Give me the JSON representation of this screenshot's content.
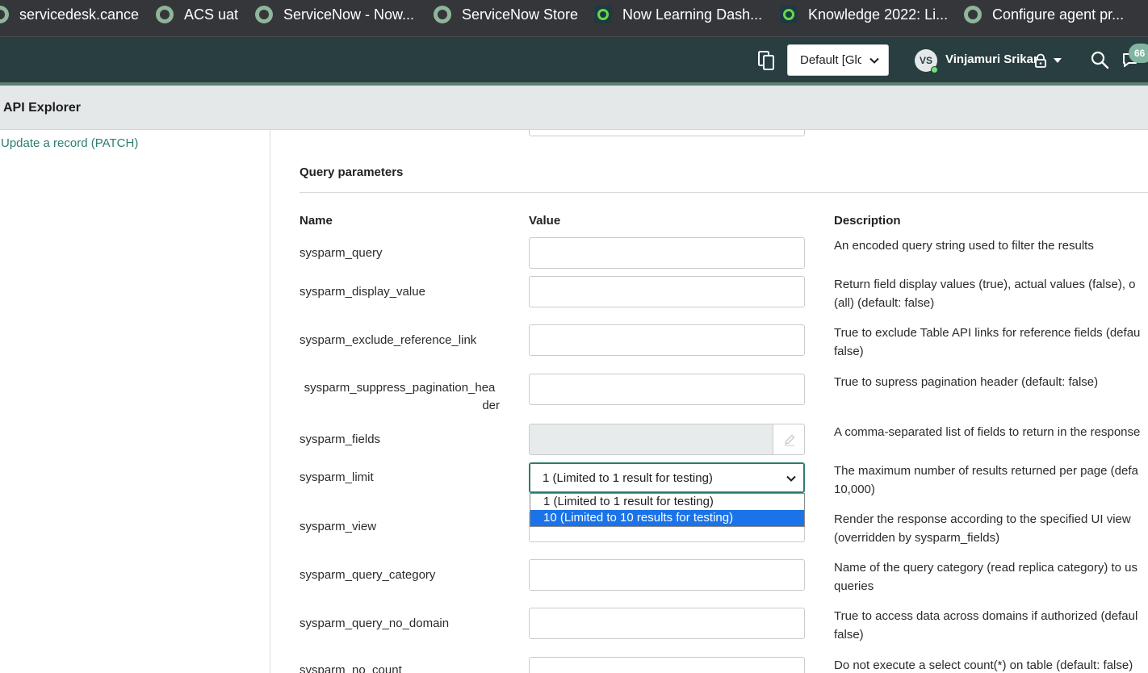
{
  "bookmarks": [
    {
      "label": "servicedesk.cance",
      "icon": "servicenow-icon"
    },
    {
      "label": "ACS uat",
      "icon": "servicenow-icon"
    },
    {
      "label": "ServiceNow - Now...",
      "icon": "servicenow-icon"
    },
    {
      "label": "ServiceNow Store",
      "icon": "servicenow-icon"
    },
    {
      "label": "Now Learning Dash...",
      "icon": "now-learning-icon"
    },
    {
      "label": "Knowledge 2022: Li...",
      "icon": "now-learning-icon"
    },
    {
      "label": "Configure agent pr...",
      "icon": "servicenow-icon"
    }
  ],
  "header": {
    "scope_value": "Default [Global]",
    "user_initials": "VS",
    "user_name": "Vinjamuri Srikar",
    "notification_count": "66"
  },
  "page": {
    "title": "API Explorer"
  },
  "leftnav": {
    "link_label": "Update a record  (PATCH)"
  },
  "query": {
    "section_title": "Query parameters",
    "columns": {
      "name": "Name",
      "value": "Value",
      "description": "Description"
    },
    "params": [
      {
        "name": "sysparm_query",
        "value": "",
        "desc1": "An encoded query string used to filter the results",
        "desc2": ""
      },
      {
        "name": "sysparm_display_value",
        "value": "",
        "desc1": "Return field display values (true), actual values (false), o",
        "desc2": "(all) (default: false)"
      },
      {
        "name": "sysparm_exclude_reference_link",
        "value": "",
        "desc1": "True to exclude Table API links for reference fields (defau",
        "desc2": "false)"
      },
      {
        "name_line1": "sysparm_suppress_pagination_hea",
        "name_line2": "der",
        "value": "",
        "desc1": "True to supress pagination header (default: false)",
        "desc2": ""
      },
      {
        "name": "sysparm_fields",
        "value": "",
        "desc1": "A comma-separated list of fields to return in the response",
        "desc2": ""
      },
      {
        "name": "sysparm_limit",
        "value": "1 (Limited to 1 result for testing)",
        "desc1": "The maximum number of results returned per page (defa",
        "desc2": "10,000)"
      },
      {
        "name": "sysparm_view",
        "value": "",
        "desc1": "Render the response according to the specified UI view",
        "desc2": "(overridden by sysparm_fields)"
      },
      {
        "name": "sysparm_query_category",
        "value": "",
        "desc1": "Name of the query category (read replica category) to us",
        "desc2": "queries"
      },
      {
        "name": "sysparm_query_no_domain",
        "value": "",
        "desc1": "True to access data across domains if authorized (defaul",
        "desc2": "false)"
      },
      {
        "name": "sysparm_no_count",
        "value": "",
        "desc1": "Do not execute a select count(*) on table (default: false)",
        "desc2": ""
      }
    ],
    "limit_options": [
      "1 (Limited to 1 result for testing)",
      "10 (Limited to 10 results for testing)"
    ],
    "limit_highlighted_option": "10 (Limited to 10 results for testing)"
  },
  "colors": {
    "header_bg": "#293e40",
    "accent": "#2e7d6f",
    "dropdown_highlight": "#1a73e8"
  }
}
